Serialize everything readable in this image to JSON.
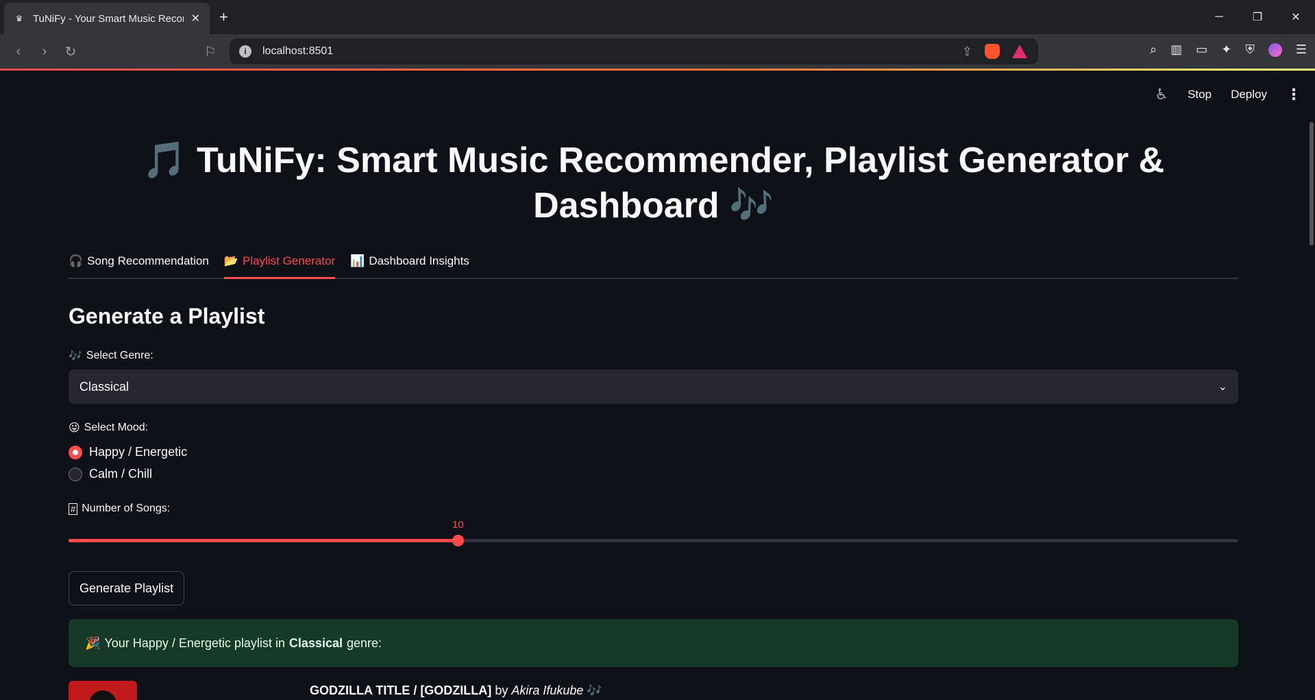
{
  "browser": {
    "tab_title": "TuNiFy - Your Smart Music Recon",
    "url": "localhost:8501",
    "favicon": "crown-icon",
    "new_tab_symbol": "+"
  },
  "streamlit_header": {
    "stop_label": "Stop",
    "deploy_label": "Deploy"
  },
  "page": {
    "title_line1": "TuNiFy: Smart Music Recommender, Playlist Generator &",
    "title_line2": "Dashboard",
    "tabs": [
      {
        "icon": "🎧",
        "label": "Song Recommendation",
        "active": false
      },
      {
        "icon": "📂",
        "label": "Playlist Generator",
        "active": true
      },
      {
        "icon": "📊",
        "label": "Dashboard Insights",
        "active": false
      }
    ],
    "heading": "Generate a Playlist",
    "genre_label": "Select Genre:",
    "genre_value": "Classical",
    "mood_label": "Select Mood:",
    "mood_options": [
      "Happy / Energetic",
      "Calm / Chill"
    ],
    "mood_selected": "Happy / Energetic",
    "songs_label": "Number of Songs:",
    "songs_value": "10",
    "songs_fraction": 0.333,
    "generate_label": "Generate Playlist",
    "alert_prefix": "Your Happy / Energetic playlist in",
    "alert_genre": "Classical",
    "alert_suffix": "genre:",
    "first_song_title": "GODZILLA TITLE / [GODZILLA]",
    "first_song_by": "by",
    "first_song_artist": "Akira Ifukube"
  },
  "colors": {
    "accent": "#ff4b4b",
    "background": "#0e1117",
    "success_bg": "#173928"
  }
}
